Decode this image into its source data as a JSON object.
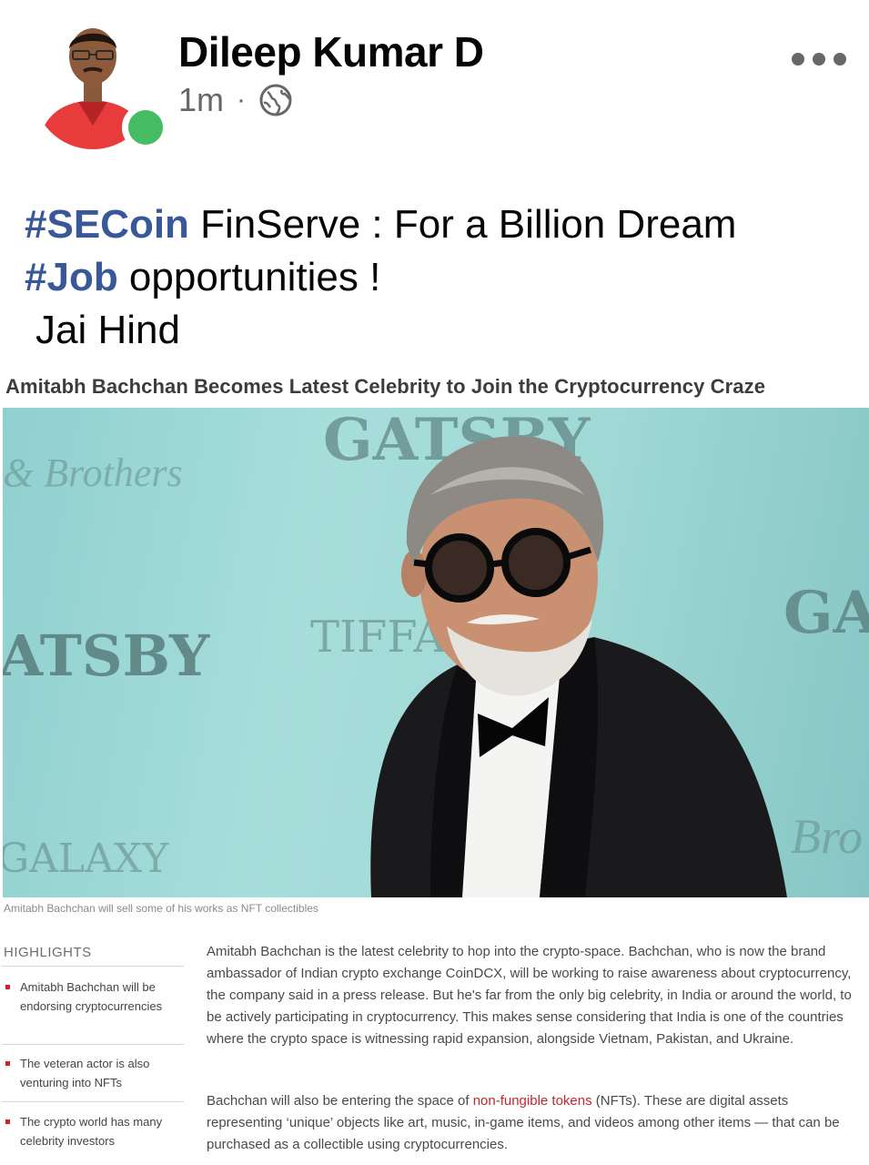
{
  "post": {
    "author": "Dileep Kumar D",
    "time": "1m",
    "separator": "·",
    "privacy_icon": "globe-icon",
    "more_icon": "more-options-icon",
    "presence_color": "#45bd62",
    "hashtag_color": "#385898",
    "text": {
      "line1_hashtag": "#SECoin",
      "line1_rest": " FinServe : For a Billion Dream",
      "line2_hashtag": "#Job",
      "line2_rest": " opportunities !",
      "line3": "Jai Hind"
    }
  },
  "article": {
    "headline": "Amitabh Bachchan Becomes Latest Celebrity to Join the Cryptocurrency Craze",
    "photo_backdrop": {
      "word_top": "GATSBY",
      "word_left": "ATSBY",
      "word_center": "TIFFA",
      "word_right": "GA",
      "word_bottom": "GALAXY",
      "script_left": "& Brothers",
      "script_right": "Bro"
    },
    "caption": "Amitabh Bachchan will sell some of his works as NFT collectibles",
    "highlights_title": "HIGHLIGHTS",
    "highlights": [
      "Amitabh Bachchan will be endorsing cryptocurrencies",
      "The veteran actor is also venturing into NFTs",
      "The crypto world has many celebrity investors"
    ],
    "paragraph1": "Amitabh Bachchan is the latest celebrity to hop into the crypto-space. Bachchan, who is now the brand ambassador of Indian crypto exchange CoinDCX, will be working to raise awareness about cryptocurrency, the company said in a press release. But he's far from the only big celebrity, in India or around the world, to be actively participating in cryptocurrency. This makes sense considering that India is one of the countries where the crypto space is witnessing rapid expansion, alongside Vietnam, Pakistan, and Ukraine.",
    "paragraph2_start": "Bachchan will also be entering the space of ",
    "paragraph2_link": "non-fungible tokens",
    "paragraph2_end": " (NFTs). These are digital assets representing ‘unique’ objects like art, music, in-game items, and videos among other items — that can be purchased as a collectible using cryptocurrencies."
  }
}
